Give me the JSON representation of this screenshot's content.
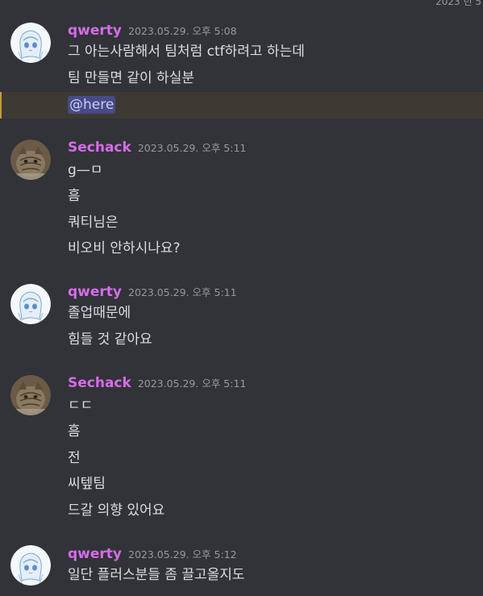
{
  "top_timestamp": "2023 년 5",
  "messages": [
    {
      "author": "qwerty",
      "timestamp": "2023.05.29. 오후 5:08",
      "lines": [
        "그 아는사람해서 팀처럼 ctf하려고 하는데",
        "팀 만들면 같이 하실분"
      ],
      "mention": "@here"
    },
    {
      "author": "Sechack",
      "timestamp": "2023.05.29. 오후 5:11",
      "lines": [
        "g—ㅁ",
        "흠",
        "쿼티님은",
        "비오비 안하시나요?"
      ]
    },
    {
      "author": "qwerty",
      "timestamp": "2023.05.29. 오후 5:11",
      "lines": [
        "졸업때문에",
        "힘들 것 같아요"
      ]
    },
    {
      "author": "Sechack",
      "timestamp": "2023.05.29. 오후 5:11",
      "lines": [
        "ㄷㄷ",
        "흠",
        "전",
        "씨텦팀",
        "드갈 의향 있어요"
      ]
    },
    {
      "author": "qwerty",
      "timestamp": "2023.05.29. 오후 5:12",
      "lines": [
        "일단 플러스분들 좀 끌고올지도"
      ]
    }
  ],
  "colors": {
    "background": "#313338",
    "username": "#d66ce8",
    "text": "#dbdee1",
    "timestamp": "#949ba4",
    "mention_highlight": "#3e3a31",
    "mention_pill": "#474b87"
  }
}
